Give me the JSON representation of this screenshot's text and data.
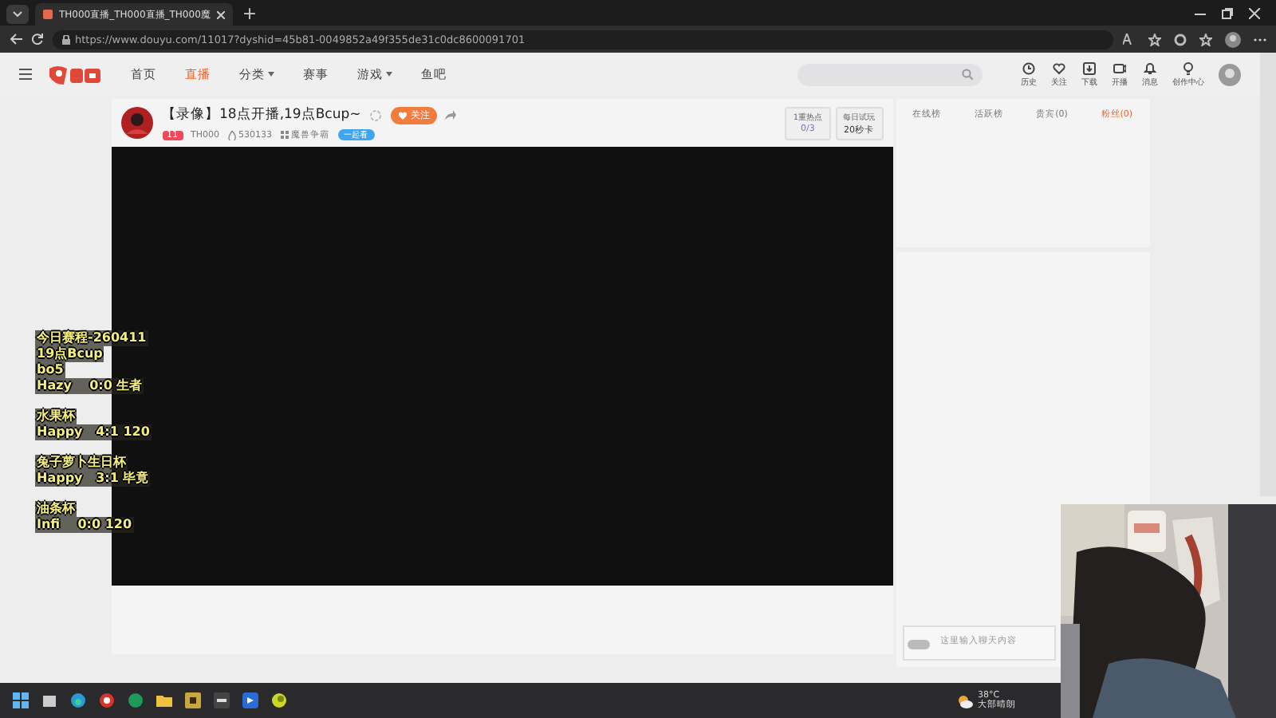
{
  "browser": {
    "tabs": [
      {
        "title": "TH000直播_TH000直播_TH000魔",
        "selected": true
      }
    ],
    "new_tab": "+",
    "url": "https://www.douyu.com/11017?dyshid=45b81-0049852a49f355de31c0dc8600091701"
  },
  "header": {
    "nav": [
      {
        "label": "首页",
        "selected": false,
        "dropdown": false
      },
      {
        "label": "直播",
        "selected": true,
        "dropdown": false
      },
      {
        "label": "分类",
        "selected": false,
        "dropdown": true
      },
      {
        "label": "赛事",
        "selected": false,
        "dropdown": false
      },
      {
        "label": "游戏",
        "selected": false,
        "dropdown": true
      },
      {
        "label": "鱼吧",
        "selected": false,
        "dropdown": false
      }
    ],
    "actions": [
      {
        "kind": "history",
        "label": "历史"
      },
      {
        "kind": "heart",
        "label": "关注"
      },
      {
        "kind": "download",
        "label": "下载"
      },
      {
        "kind": "live",
        "label": "开播"
      },
      {
        "kind": "bell",
        "label": "消息"
      },
      {
        "kind": "bulb",
        "label": "创作中心"
      }
    ]
  },
  "room": {
    "title": "【录像】18点开播,19点Bcup~",
    "follow": "关注",
    "level": "11",
    "streamer": "TH000",
    "fans": "530133",
    "category": "魔兽争霸",
    "watch_together": "一起看",
    "stats": [
      {
        "label": "1重热点",
        "value": "0/3"
      },
      {
        "label": "每日试玩",
        "value": "20秒卡"
      }
    ]
  },
  "overlay": [
    {
      "lines": [
        "今日赛程-260411",
        "19点Bcup",
        "bo5",
        "Hazy    0:0 生者"
      ]
    },
    {
      "lines": [
        "水果杯",
        "Happy   4:1 120"
      ]
    },
    {
      "lines": [
        "兔子萝卜生日杯",
        "Happy   3:1 毕竟"
      ]
    },
    {
      "lines": [
        "油条杯",
        "Infi    0:0 120"
      ]
    }
  ],
  "rank_tabs": [
    {
      "label": "在线榜",
      "selected": false
    },
    {
      "label": "活跃榜",
      "selected": false
    },
    {
      "label": "贵宾(0)",
      "selected": false
    },
    {
      "label": "粉丝(0)",
      "selected": true
    }
  ],
  "chat": {
    "placeholder": "这里输入聊天内容"
  },
  "taskbar": {
    "apps": [
      {
        "kind": "explorer"
      },
      {
        "kind": "edge"
      },
      {
        "kind": "chrome"
      },
      {
        "kind": "green"
      },
      {
        "kind": "folder"
      },
      {
        "kind": "game"
      },
      {
        "kind": "dark"
      },
      {
        "kind": "blue"
      },
      {
        "kind": "moon"
      }
    ],
    "weather": {
      "temp": "38°C",
      "text": "大部晴朗"
    }
  }
}
